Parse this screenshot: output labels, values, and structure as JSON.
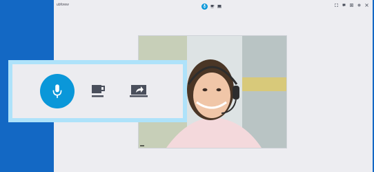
{
  "window": {
    "title": "ubforew"
  },
  "call": {
    "caller_label": "",
    "controls": {
      "mic": "microphone-icon",
      "hold": "hold-cup-icon",
      "share": "share-screen-icon"
    }
  },
  "colors": {
    "desktop": "#1368c4",
    "accent": "#0a97d9",
    "callout_border": "#aee2fa",
    "icon": "#4a4f5c"
  }
}
